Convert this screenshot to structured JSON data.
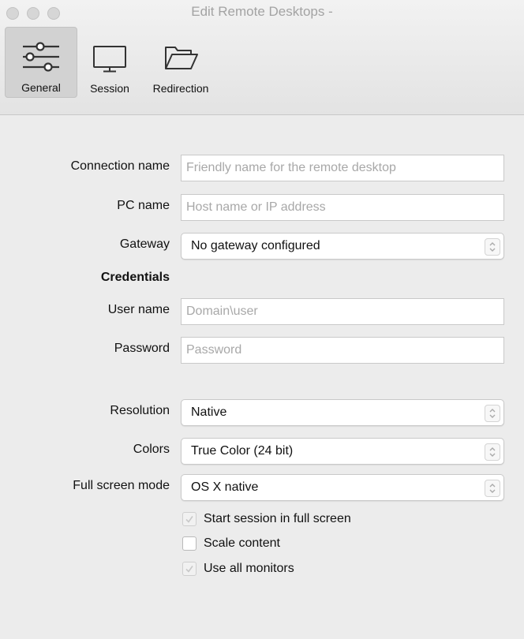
{
  "window": {
    "title": "Edit Remote Desktops -"
  },
  "toolbar": {
    "items": [
      {
        "label": "General",
        "icon": "sliders-icon",
        "active": true
      },
      {
        "label": "Session",
        "icon": "monitor-icon",
        "active": false
      },
      {
        "label": "Redirection",
        "icon": "folder-icon",
        "active": false
      }
    ]
  },
  "form": {
    "connection_name": {
      "label": "Connection name",
      "placeholder": "Friendly name for the remote desktop",
      "value": ""
    },
    "pc_name": {
      "label": "PC name",
      "placeholder": "Host name or IP address",
      "value": ""
    },
    "gateway": {
      "label": "Gateway",
      "value": "No gateway configured"
    },
    "credentials_heading": "Credentials",
    "user_name": {
      "label": "User name",
      "placeholder": "Domain\\user",
      "value": ""
    },
    "password": {
      "label": "Password",
      "placeholder": "Password",
      "value": ""
    },
    "resolution": {
      "label": "Resolution",
      "value": "Native"
    },
    "colors": {
      "label": "Colors",
      "value": "True Color (24 bit)"
    },
    "full_screen_mode": {
      "label": "Full screen mode",
      "value": "OS X native"
    },
    "checkboxes": [
      {
        "label": "Start session in full screen",
        "checked": true,
        "enabled": false
      },
      {
        "label": "Scale content",
        "checked": false,
        "enabled": true
      },
      {
        "label": "Use all monitors",
        "checked": true,
        "enabled": false
      }
    ]
  }
}
